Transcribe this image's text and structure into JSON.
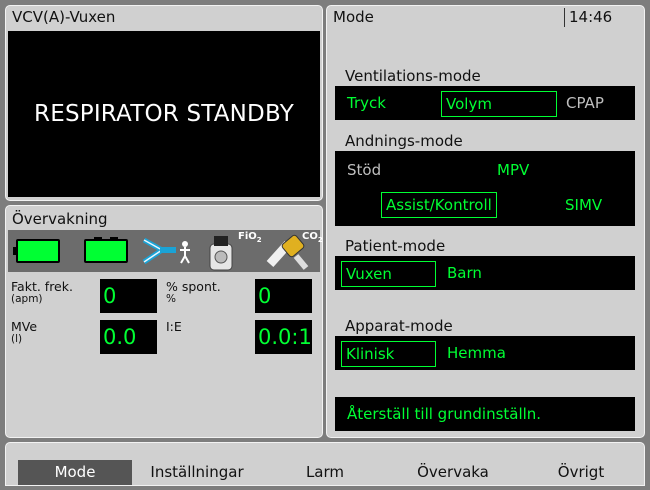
{
  "status_panel": {
    "title": "VCV(A)-Vuxen",
    "message": "RESPIRATOR STANDBY"
  },
  "monitor": {
    "title": "Övervakning",
    "icons": [
      "battery-icon",
      "battery-icon",
      "patient-circuit-icon",
      "fio2-sensor-icon",
      "co2-sensor-icon"
    ],
    "fio2_label": "FiO",
    "fio2_sub": "2",
    "co2_label": "CO",
    "co2_sub": "2",
    "fakt_frek": {
      "label": "Fakt. frek.",
      "unit": "(apm)",
      "value": "0"
    },
    "spont": {
      "label": "% spont.",
      "unit": "%",
      "value": "0"
    },
    "mve": {
      "label": "MVe",
      "unit": "(l)",
      "value": "0.0"
    },
    "ie": {
      "label": "I:E",
      "value": "0.0:1"
    }
  },
  "mode_panel": {
    "title": "Mode",
    "clock": "14:46",
    "ventilation": {
      "label": "Ventilations-mode",
      "options": [
        "Tryck",
        "Volym",
        "CPAP"
      ],
      "selected": "Volym"
    },
    "breathing": {
      "label": "Andnings-mode",
      "options": [
        "Stöd",
        "MPV",
        "Assist/Kontroll",
        "SIMV"
      ],
      "selected": "Assist/Kontroll"
    },
    "patient": {
      "label": "Patient-mode",
      "options": [
        "Vuxen",
        "Barn"
      ],
      "selected": "Vuxen"
    },
    "device": {
      "label": "Apparat-mode",
      "options": [
        "Klinisk",
        "Hemma"
      ],
      "selected": "Klinisk"
    },
    "reset_label": "Återställ till grundinställn."
  },
  "tabs": [
    "Mode",
    "Inställningar",
    "Larm",
    "Övervaka",
    "Övrigt"
  ],
  "active_tab": "Mode",
  "colors": {
    "accent_green": "#00ff33",
    "panel": "#d0d0d0",
    "screen": "#000000",
    "active_tab": "#555555"
  }
}
